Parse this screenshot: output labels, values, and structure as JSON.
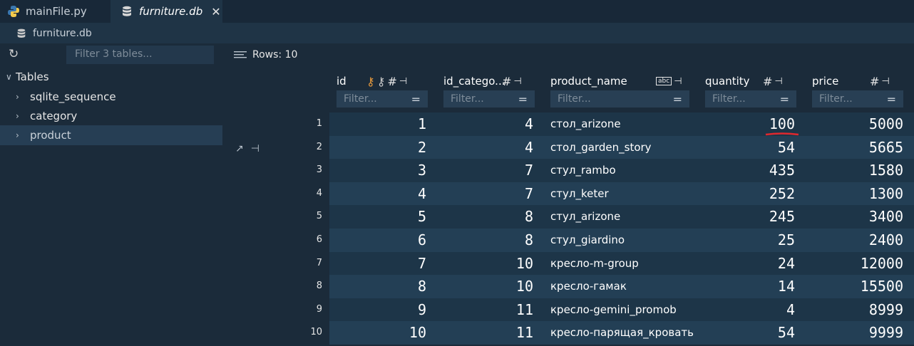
{
  "tabs": [
    {
      "label": "mainFile.py",
      "icon": "python-icon",
      "active": false
    },
    {
      "label": "furniture.db",
      "icon": "database-icon",
      "active": true
    }
  ],
  "breadcrumb": {
    "label": "furniture.db",
    "icon": "database-icon"
  },
  "sidebar": {
    "filter_placeholder": "Filter 3 tables...",
    "root_label": "Tables",
    "tables": [
      "sqlite_sequence",
      "category",
      "product"
    ],
    "selected": "product"
  },
  "main": {
    "rows_label": "Rows: 10",
    "filter_placeholder": "Filter...",
    "columns": [
      "id",
      "id_catego...",
      "product_name",
      "quantity",
      "price"
    ],
    "rows": [
      {
        "n": "1",
        "id": "1",
        "id_category": "4",
        "product_name": "стол_arizone",
        "quantity": "100",
        "price": "5000"
      },
      {
        "n": "2",
        "id": "2",
        "id_category": "4",
        "product_name": "стол_garden_story",
        "quantity": "54",
        "price": "5665"
      },
      {
        "n": "3",
        "id": "3",
        "id_category": "7",
        "product_name": "стул_rambo",
        "quantity": "435",
        "price": "1580"
      },
      {
        "n": "4",
        "id": "4",
        "id_category": "7",
        "product_name": "стул_keter",
        "quantity": "252",
        "price": "1300"
      },
      {
        "n": "5",
        "id": "5",
        "id_category": "8",
        "product_name": "стул_arizone",
        "quantity": "245",
        "price": "3400"
      },
      {
        "n": "6",
        "id": "6",
        "id_category": "8",
        "product_name": "стул_giardino",
        "quantity": "25",
        "price": "2400"
      },
      {
        "n": "7",
        "id": "7",
        "id_category": "10",
        "product_name": "кресло-m-group",
        "quantity": "24",
        "price": "12000"
      },
      {
        "n": "8",
        "id": "8",
        "id_category": "10",
        "product_name": "кресло-гамак",
        "quantity": "14",
        "price": "15500"
      },
      {
        "n": "9",
        "id": "9",
        "id_category": "11",
        "product_name": "кресло-gemini_promob",
        "quantity": "4",
        "price": "8999"
      },
      {
        "n": "10",
        "id": "10",
        "id_category": "11",
        "product_name": "кресло-парящая_кровать",
        "quantity": "54",
        "price": "9999"
      }
    ]
  },
  "colors": {
    "accent": "#1f3446",
    "annotation": "#e0282e",
    "key": "#e89a3c"
  }
}
